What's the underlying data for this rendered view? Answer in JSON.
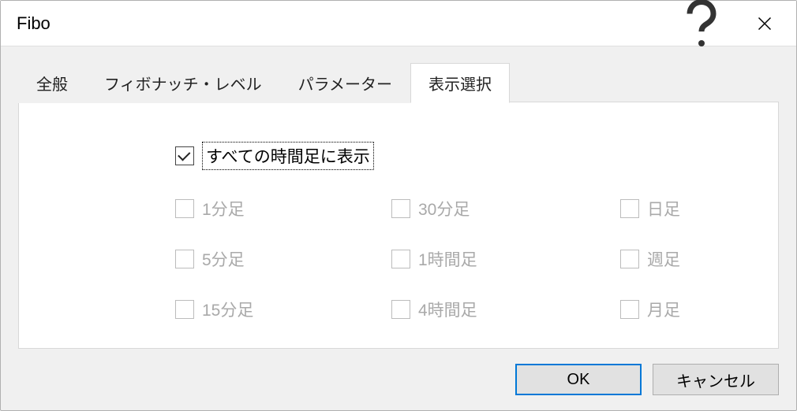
{
  "title": "Fibo",
  "tabs": [
    {
      "label": "全般"
    },
    {
      "label": "フィボナッチ・レベル"
    },
    {
      "label": "パラメーター"
    },
    {
      "label": "表示選択"
    }
  ],
  "activeTab": 3,
  "master": {
    "label": "すべての時間足に表示",
    "checked": true
  },
  "options": {
    "col1": [
      {
        "label": "1分足"
      },
      {
        "label": "5分足"
      },
      {
        "label": "15分足"
      }
    ],
    "col2": [
      {
        "label": "30分足"
      },
      {
        "label": "1時間足"
      },
      {
        "label": "4時間足"
      }
    ],
    "col3": [
      {
        "label": "日足"
      },
      {
        "label": "週足"
      },
      {
        "label": "月足"
      }
    ]
  },
  "buttons": {
    "ok": "OK",
    "cancel": "キャンセル"
  }
}
